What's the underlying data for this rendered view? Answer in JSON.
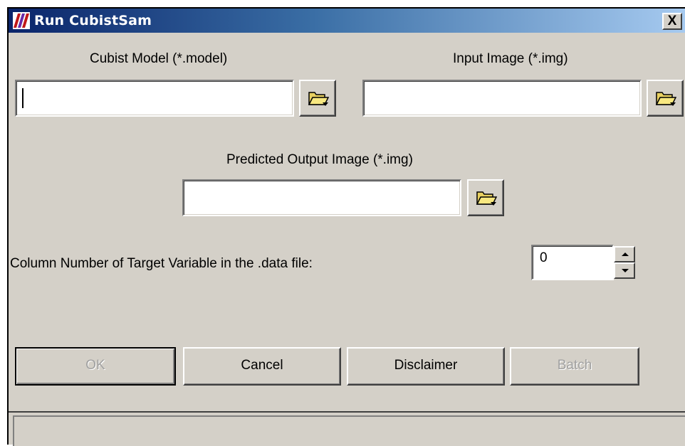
{
  "window": {
    "title": "Run CubistSam",
    "close_label": "X"
  },
  "cubist_model": {
    "label": "Cubist Model (*.model)",
    "value": ""
  },
  "input_image": {
    "label": "Input Image (*.img)",
    "value": ""
  },
  "output_image": {
    "label": "Predicted Output Image (*.img)",
    "value": ""
  },
  "target_column": {
    "label": "Column Number of Target Variable in the .data file:",
    "value": "0"
  },
  "buttons": {
    "ok": "OK",
    "cancel": "Cancel",
    "disclaimer": "Disclaimer",
    "batch": "Batch"
  },
  "status": {
    "text": ""
  },
  "icons": {
    "app": "app-logo-icon",
    "browse": "folder-open-icon",
    "spin_up": "arrow-up-icon",
    "spin_down": "arrow-down-icon"
  },
  "colors": {
    "titlebar_start": "#0a246a",
    "titlebar_end": "#a6caf0",
    "dialog_bg": "#d4d0c8"
  }
}
